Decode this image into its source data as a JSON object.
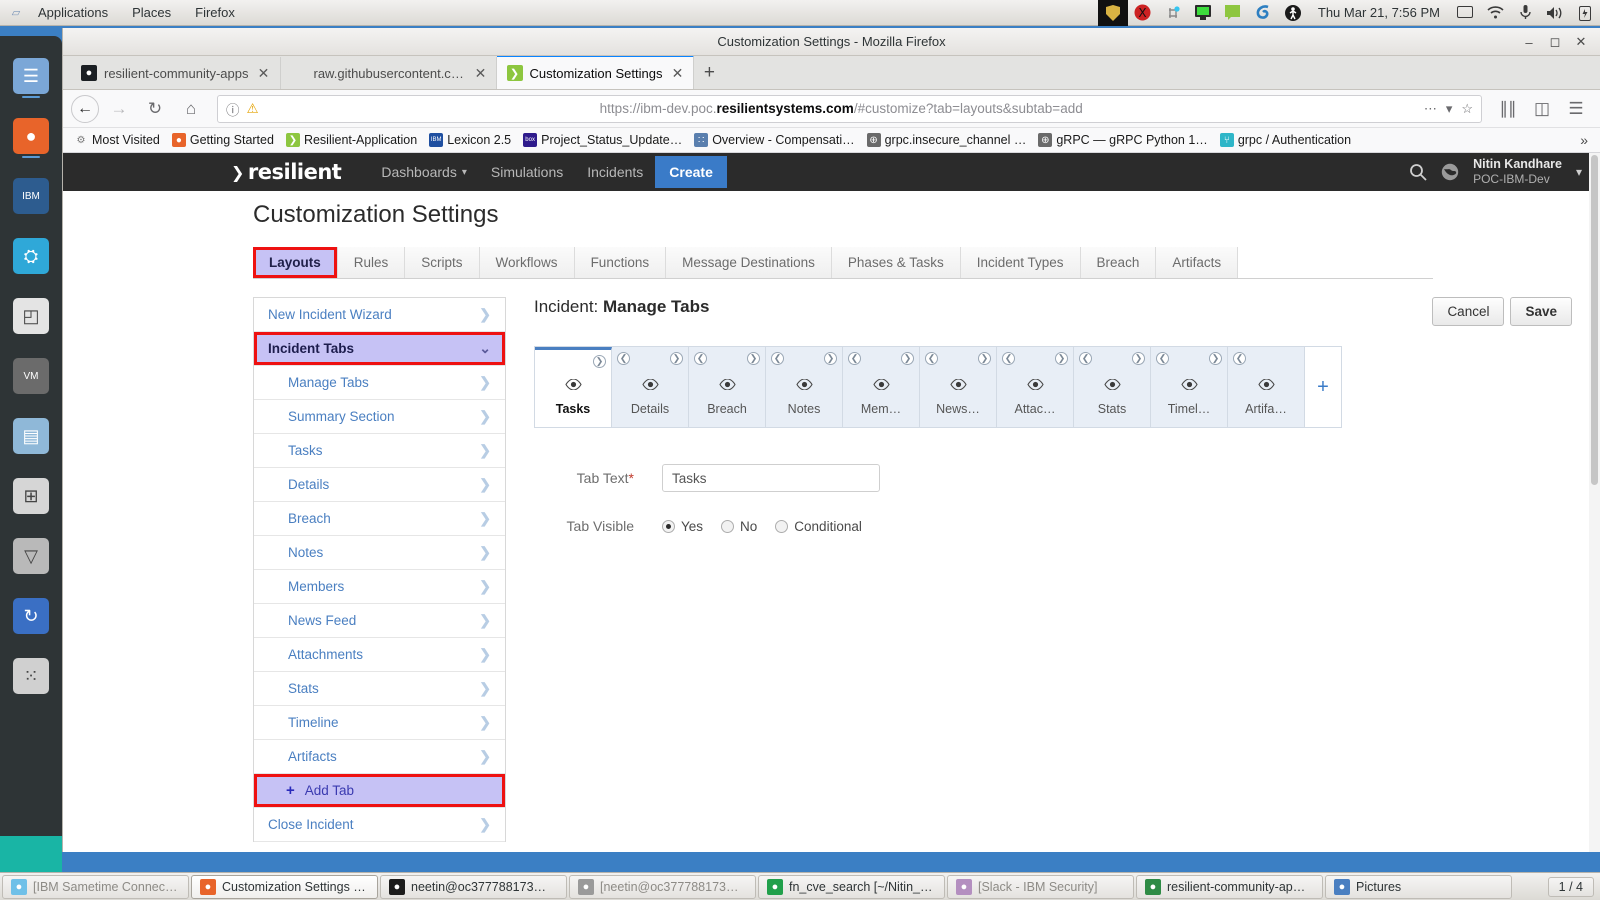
{
  "desktop": {
    "panel": {
      "logo_icon": "gnome-foot-icon",
      "menus": [
        "Applications",
        "Places",
        "Firefox"
      ],
      "tray_icons": [
        "shield-icon",
        "x-server-icon",
        "slack-icon",
        "terminal-monitor-icon",
        "note-icon",
        "spiral-icon",
        "accessibility-icon"
      ],
      "clock": "Thu Mar 21,  7:56 PM",
      "status_icons": [
        "display-icon",
        "wifi-icon",
        "microphone-icon",
        "volume-icon",
        "battery-icon"
      ]
    },
    "dock": {
      "items": [
        {
          "name": "files-icon",
          "glyph": "☰",
          "color": "#7ba7d7",
          "running": true
        },
        {
          "name": "firefox-icon",
          "glyph": "●",
          "color": "#e8642a",
          "running": true
        },
        {
          "name": "ibm-icon",
          "glyph": "IBM",
          "color": "#2d5c8f",
          "running": false
        },
        {
          "name": "sametime-icon",
          "glyph": "⛭",
          "color": "#2fa8d8",
          "running": false
        },
        {
          "name": "libreoffice-icon",
          "glyph": "◰",
          "color": "#e4e4e4",
          "running": false
        },
        {
          "name": "vmware-icon",
          "glyph": "VM",
          "color": "#6b6b6b",
          "running": false
        },
        {
          "name": "folder-icon",
          "glyph": "▤",
          "color": "#8fb8d8",
          "running": false
        },
        {
          "name": "software-icon",
          "glyph": "⊞",
          "color": "#d6d6d6",
          "running": false
        },
        {
          "name": "trash-icon",
          "glyph": "▽",
          "color": "#b9b9b9",
          "running": false
        },
        {
          "name": "sync-icon",
          "glyph": "↻",
          "color": "#3a6fc4",
          "running": false
        },
        {
          "name": "app-grid-icon",
          "glyph": "⁙",
          "color": "#d0d0d0",
          "running": false
        }
      ]
    },
    "taskbar": {
      "items": [
        {
          "label": "[IBM Sametime Connec…",
          "icon": "sametime-icon",
          "icon_color": "#6fc0e8",
          "state": "minimized"
        },
        {
          "label": "Customization Settings …",
          "icon": "firefox-icon",
          "icon_color": "#e8642a",
          "state": "active"
        },
        {
          "label": "neetin@oc377788173…",
          "icon": "terminal-icon",
          "icon_color": "#1c1c1c",
          "state": "normal"
        },
        {
          "label": "[neetin@oc377788173…",
          "icon": "terminal-icon",
          "icon_color": "#9a9a9a",
          "state": "minimized"
        },
        {
          "label": "fn_cve_search [~/Nitin_…",
          "icon": "pycharm-icon",
          "icon_color": "#21a04b",
          "state": "normal"
        },
        {
          "label": "[Slack - IBM Security]",
          "icon": "slack-icon",
          "icon_color": "#b48fc0",
          "state": "minimized"
        },
        {
          "label": "resilient-community-ap…",
          "icon": "chrome-icon",
          "icon_color": "#2e8b45",
          "state": "normal"
        },
        {
          "label": "Pictures",
          "icon": "files-icon",
          "icon_color": "#4a7fc1",
          "state": "normal"
        }
      ],
      "workspace": "1 / 4"
    }
  },
  "browser": {
    "window_title": "Customization Settings - Mozilla Firefox",
    "window_controls": [
      "minimize-icon",
      "maximize-icon",
      "close-icon"
    ],
    "tabs": [
      {
        "title": "resilient-community-apps",
        "favicon": "github-icon",
        "favicon_color": "#1b1f23",
        "favicon_glyph": "●",
        "active": false
      },
      {
        "title": "raw.githubusercontent.com/i…",
        "favicon": "blank-icon",
        "favicon_color": "transparent",
        "favicon_glyph": "",
        "active": false
      },
      {
        "title": "Customization Settings",
        "favicon": "resilient-icon",
        "favicon_color": "#8dc63f",
        "favicon_glyph": "❯",
        "active": true
      }
    ],
    "new_tab_label": "+",
    "toolbar": {
      "back_icon": "back-arrow-icon",
      "forward_icon": "forward-arrow-icon",
      "reload_icon": "reload-icon",
      "home_icon": "home-icon",
      "library_icon": "library-icon",
      "sidebar_icon": "sidebar-icon",
      "menu_icon": "hamburger-menu-icon"
    },
    "urlbar": {
      "info_icon": "page-info-icon",
      "lock_icon": "insecure-warning-icon",
      "url_prefix": "https://ibm-dev.poc.",
      "url_domain": "resilientsystems.com",
      "url_suffix": "/#customize?tab=layouts&subtab=add",
      "page_actions_icon": "ellipsis-icon",
      "pocket_icon": "pocket-icon",
      "bookmark_icon": "star-icon"
    },
    "bookmarks": [
      {
        "label": "Most Visited",
        "icon": "gear-icon",
        "color": "#7a7a7a",
        "glyph": "⚙"
      },
      {
        "label": "Getting Started",
        "icon": "firefox-icon",
        "color": "#e8642a",
        "glyph": "●"
      },
      {
        "label": "Resilient-Application",
        "icon": "resilient-icon",
        "color": "#8dc63f",
        "glyph": "❯"
      },
      {
        "label": "Lexicon 2.5",
        "icon": "ibm-icon",
        "color": "#1f4fa0",
        "glyph": "IBM"
      },
      {
        "label": "Project_Status_Update…",
        "icon": "box-icon",
        "color": "#2f1b8c",
        "glyph": "box"
      },
      {
        "label": "Overview - Compensati…",
        "icon": "grid-icon",
        "color": "#5a7fae",
        "glyph": "∷"
      },
      {
        "label": "grpc.insecure_channel …",
        "icon": "globe-icon",
        "color": "#6a6a6a",
        "glyph": "⊕"
      },
      {
        "label": "gRPC — gRPC Python 1…",
        "icon": "globe-icon",
        "color": "#6a6a6a",
        "glyph": "⊕"
      },
      {
        "label": "grpc / Authentication",
        "icon": "grpc-icon",
        "color": "#2fb6c8",
        "glyph": "⑂"
      }
    ],
    "bookmarks_overflow": "»"
  },
  "app": {
    "brand": "resilient",
    "brand_chevron": "❯",
    "nav": [
      {
        "label": "Dashboards",
        "has_caret": true,
        "cta": false
      },
      {
        "label": "Simulations",
        "has_caret": false,
        "cta": false
      },
      {
        "label": "Incidents",
        "has_caret": false,
        "cta": false
      },
      {
        "label": "Create",
        "has_caret": false,
        "cta": true
      }
    ],
    "caret": "▾",
    "header_icons": [
      "search-icon",
      "globe-icon"
    ],
    "user": {
      "name": "Nitin Kandhare",
      "org": "POC-IBM-Dev",
      "caret": "▾"
    },
    "page_title": "Customization Settings",
    "main_tabs": [
      {
        "label": "Layouts",
        "active": true
      },
      {
        "label": "Rules",
        "active": false
      },
      {
        "label": "Scripts",
        "active": false
      },
      {
        "label": "Workflows",
        "active": false
      },
      {
        "label": "Functions",
        "active": false
      },
      {
        "label": "Message Destinations",
        "active": false
      },
      {
        "label": "Phases & Tasks",
        "active": false
      },
      {
        "label": "Incident Types",
        "active": false
      },
      {
        "label": "Breach",
        "active": false
      },
      {
        "label": "Artifacts",
        "active": false
      }
    ],
    "side_menu": [
      {
        "label": "New Incident Wizard",
        "kind": "top",
        "chevron": "❯"
      },
      {
        "label": "Incident Tabs",
        "kind": "selected",
        "chevron": "⌄"
      },
      {
        "label": "Manage Tabs",
        "kind": "sub",
        "chevron": "❯"
      },
      {
        "label": "Summary Section",
        "kind": "sub",
        "chevron": "❯"
      },
      {
        "label": "Tasks",
        "kind": "sub",
        "chevron": "❯"
      },
      {
        "label": "Details",
        "kind": "sub",
        "chevron": "❯"
      },
      {
        "label": "Breach",
        "kind": "sub",
        "chevron": "❯"
      },
      {
        "label": "Notes",
        "kind": "sub",
        "chevron": "❯"
      },
      {
        "label": "Members",
        "kind": "sub",
        "chevron": "❯"
      },
      {
        "label": "News Feed",
        "kind": "sub",
        "chevron": "❯"
      },
      {
        "label": "Attachments",
        "kind": "sub",
        "chevron": "❯"
      },
      {
        "label": "Stats",
        "kind": "sub",
        "chevron": "❯"
      },
      {
        "label": "Timeline",
        "kind": "sub",
        "chevron": "❯"
      },
      {
        "label": "Artifacts",
        "kind": "sub",
        "chevron": "❯"
      },
      {
        "label": "Add Tab",
        "kind": "addtab",
        "plus": "+"
      },
      {
        "label": "Close Incident",
        "kind": "top",
        "chevron": "❯"
      }
    ],
    "pane": {
      "title_prefix": "Incident:",
      "title_main": "Manage Tabs",
      "cancel_label": "Cancel",
      "save_label": "Save"
    },
    "tab_cards": {
      "eye_icon": "◉",
      "left_arrow": "❮",
      "right_arrow": "❯",
      "add_label": "+",
      "items": [
        {
          "name": "Tasks",
          "active": true,
          "left": false,
          "right": true
        },
        {
          "name": "Details",
          "active": false,
          "left": true,
          "right": true
        },
        {
          "name": "Breach",
          "active": false,
          "left": true,
          "right": true
        },
        {
          "name": "Notes",
          "active": false,
          "left": true,
          "right": true
        },
        {
          "name": "Mem…",
          "active": false,
          "left": true,
          "right": true
        },
        {
          "name": "News…",
          "active": false,
          "left": true,
          "right": true
        },
        {
          "name": "Attac…",
          "active": false,
          "left": true,
          "right": true
        },
        {
          "name": "Stats",
          "active": false,
          "left": true,
          "right": true
        },
        {
          "name": "Timel…",
          "active": false,
          "left": true,
          "right": true
        },
        {
          "name": "Artifa…",
          "active": false,
          "left": true,
          "right": false
        }
      ]
    },
    "form": {
      "tab_text_label": "Tab Text",
      "required_mark": "*",
      "tab_text_value": "Tasks",
      "tab_visible_label": "Tab Visible",
      "visible_options": [
        {
          "label": "Yes",
          "selected": true
        },
        {
          "label": "No",
          "selected": false
        },
        {
          "label": "Conditional",
          "selected": false
        }
      ]
    },
    "colors": {
      "accent_blue": "#3a7bc8",
      "highlight_lavender": "#c6c2f5",
      "annotation_red": "#ee1111",
      "link_blue": "#4a7fc1"
    }
  }
}
